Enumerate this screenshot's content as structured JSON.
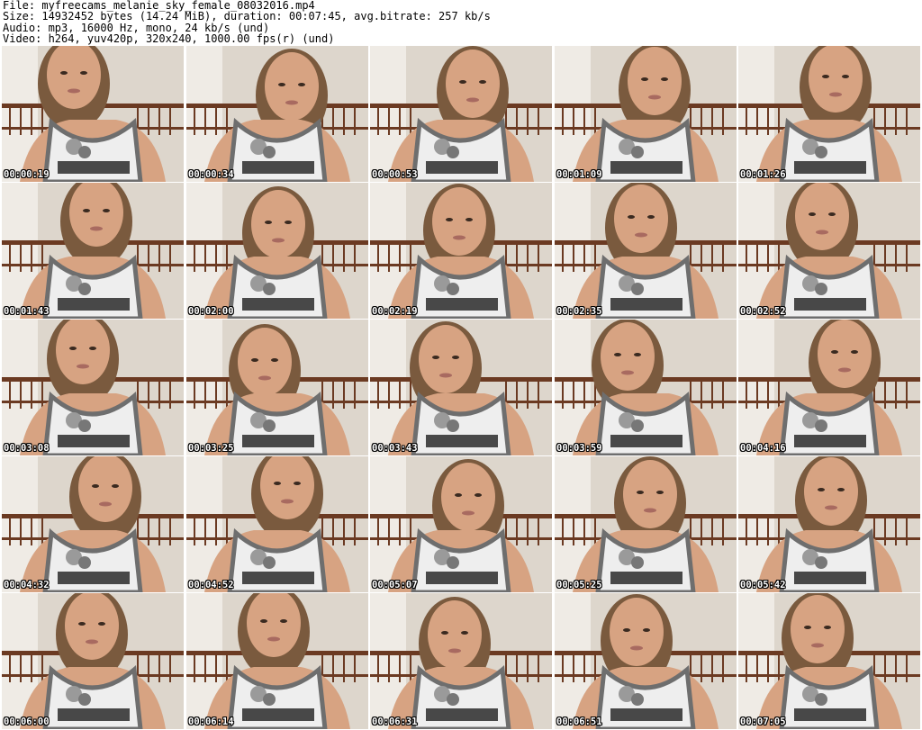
{
  "header": {
    "file": "File: myfreecams_melanie_sky_female_08032016.mp4",
    "size": "Size: 14932452 bytes (14.24 MiB), duration: 00:07:45, avg.bitrate: 257 kb/s",
    "audio": "Audio: mp3, 16000 Hz, mono, 24 kb/s (und)",
    "video": "Video: h264, yuv420p, 320x240, 1000.00 fps(r) (und)"
  },
  "thumbnails": [
    {
      "time": "00:00:19"
    },
    {
      "time": "00:00:34"
    },
    {
      "time": "00:00:53"
    },
    {
      "time": "00:01:09"
    },
    {
      "time": "00:01:26"
    },
    {
      "time": "00:01:43"
    },
    {
      "time": "00:02:00"
    },
    {
      "time": "00:02:19"
    },
    {
      "time": "00:02:35"
    },
    {
      "time": "00:02:52"
    },
    {
      "time": "00:03:08"
    },
    {
      "time": "00:03:25"
    },
    {
      "time": "00:03:43"
    },
    {
      "time": "00:03:59"
    },
    {
      "time": "00:04:16"
    },
    {
      "time": "00:04:32"
    },
    {
      "time": "00:04:52"
    },
    {
      "time": "00:05:07"
    },
    {
      "time": "00:05:25"
    },
    {
      "time": "00:05:42"
    },
    {
      "time": "00:06:00"
    },
    {
      "time": "00:06:14"
    },
    {
      "time": "00:06:31"
    },
    {
      "time": "00:06:51"
    },
    {
      "time": "00:07:05"
    }
  ],
  "colors": {
    "wall": "#ddd6cc",
    "rail": "#6b3a22",
    "skin": "#d7a382",
    "hair": "#7a5a3e",
    "shirt": "#eeeeee",
    "shirt_trim": "#6e6e6e",
    "shirt_text": "#2a2a2a"
  }
}
